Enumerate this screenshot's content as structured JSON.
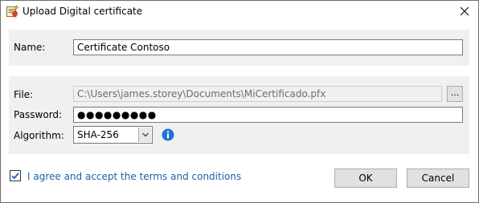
{
  "window": {
    "title": "Upload Digital certificate",
    "icons": {
      "app": "certificate-icon",
      "close": "close-icon"
    }
  },
  "name_section": {
    "label": "Name:",
    "value": "Certificate Contoso"
  },
  "certificate_section": {
    "file_label": "File:",
    "file_path": "C:\\Users\\james.storey\\Documents\\MiCertificado.pfx",
    "browse_label": "...",
    "password_label": "Password:",
    "password_value": "●●●●●●●●●",
    "algorithm_label": "Algorithm:",
    "algorithm_value": "SHA-256",
    "info_icon": "info-icon"
  },
  "footer": {
    "agree_checked": true,
    "agree_text": "I agree and accept the terms and conditions",
    "ok_label": "OK",
    "cancel_label": "Cancel"
  },
  "colors": {
    "panel_bg": "#f0f0f0",
    "link": "#1f5fa8",
    "info_blue": "#1e73d2",
    "checkbox_check": "#1e5fb4"
  }
}
